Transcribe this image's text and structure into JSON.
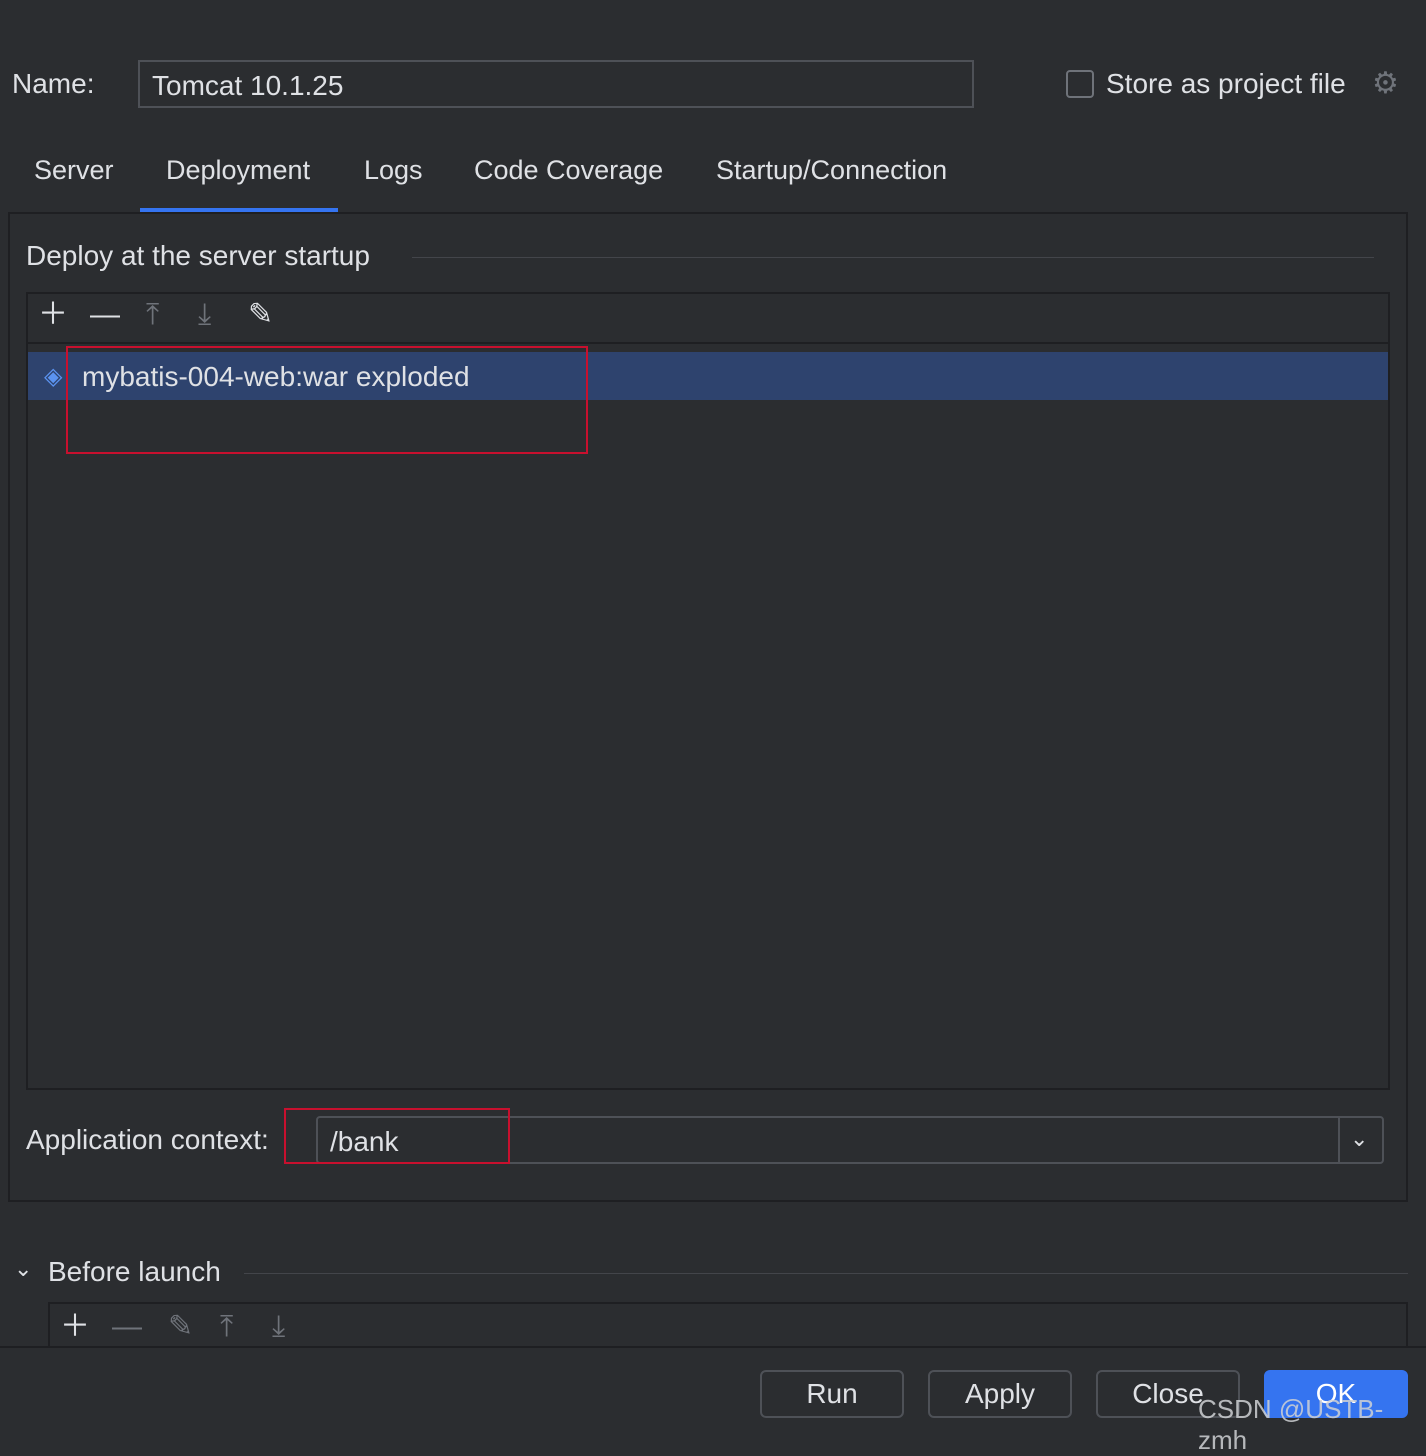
{
  "name_label": "Name:",
  "name_value": "Tomcat 10.1.25",
  "store_label": "Store as project file",
  "tabs": [
    "Server",
    "Deployment",
    "Logs",
    "Code Coverage",
    "Startup/Connection"
  ],
  "active_tab": "Deployment",
  "section_title": "Deploy at the server startup",
  "artifacts": [
    "mybatis-004-web:war exploded"
  ],
  "app_context_label": "Application context:",
  "app_context_value": "/bank",
  "before_launch_label": "Before launch",
  "buttons": {
    "run": "Run",
    "apply": "Apply",
    "close": "Close",
    "ok": "OK"
  },
  "watermark": "CSDN @USTB-zmh",
  "colors": {
    "accent": "#3574f0",
    "selection": "#2e436e",
    "annotation": "#c8102e"
  }
}
